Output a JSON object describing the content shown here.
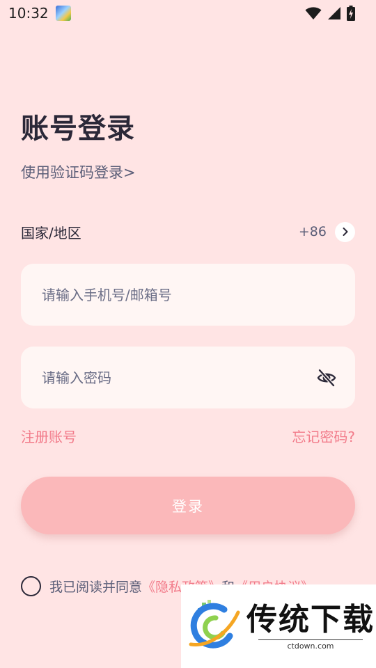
{
  "status_bar": {
    "time": "10:32",
    "icons": [
      "notification-image-icon",
      "wifi-icon",
      "signal-icon",
      "battery-charging-icon"
    ]
  },
  "login": {
    "title": "账号登录",
    "code_login_link": "使用验证码登录>",
    "region": {
      "label": "国家/地区",
      "code": "+86"
    },
    "phone_input": {
      "value": "",
      "placeholder": "请输入手机号/邮箱号"
    },
    "password_input": {
      "value": "",
      "placeholder": "请输入密码"
    },
    "register_link": "注册账号",
    "forgot_link": "忘记密码?",
    "login_button": "登录",
    "agreement": {
      "prefix": "我已阅读并同意",
      "privacy": "《隐私政策》",
      "and": "和",
      "terms": "《用户协议》"
    }
  },
  "watermark": {
    "title": "传统下载",
    "url": "ctdown.com"
  },
  "colors": {
    "background": "#ffe4e4",
    "accent": "#f27b8a",
    "button": "#fbb8ba",
    "input_bg": "#fff6f4",
    "title_text": "#2b2838"
  }
}
